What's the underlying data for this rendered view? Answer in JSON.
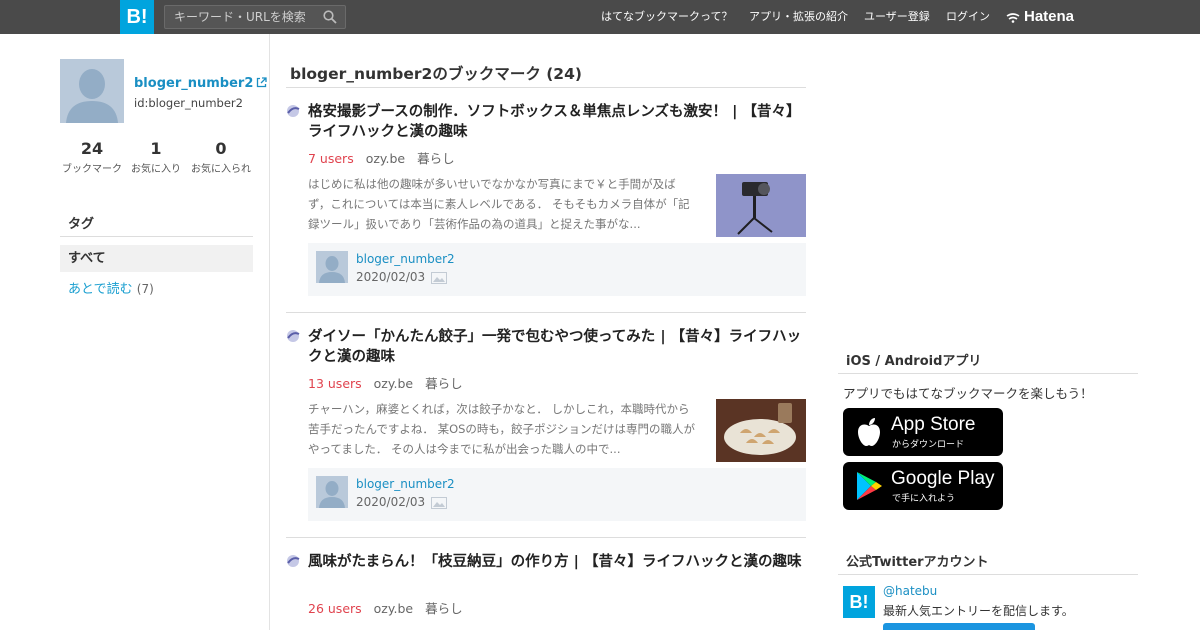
{
  "header": {
    "logo": "B!",
    "search_placeholder": "キーワード・URLを検索",
    "nav": [
      "はてなブックマークって？",
      "アプリ・拡張の紹介",
      "ユーザー登録",
      "ログイン"
    ],
    "brand": "Hatena"
  },
  "profile": {
    "username": "bloger_number2",
    "user_id": "id:bloger_number2",
    "stats": [
      {
        "value": "24",
        "label": "ブックマーク"
      },
      {
        "value": "1",
        "label": "お気に入り"
      },
      {
        "value": "0",
        "label": "お気に入られ"
      }
    ]
  },
  "tags": {
    "heading": "タグ",
    "all_label": "すべて",
    "items": [
      {
        "name": "あとで読む",
        "count": "(7)"
      }
    ]
  },
  "main": {
    "title": "bloger_number2のブックマーク (24)",
    "entries": [
      {
        "title": "格安撮影ブースの制作．ソフトボックス＆単焦点レンズも激安！ | 【昔々】ライフハックと漢の趣味",
        "users": "7 users",
        "domain": "ozy.be",
        "category": "暮らし",
        "description": "はじめに私は他の趣味が多いせいでなかなか写真にまで￥と手間が及ばず，これについては本当に素人レベルである． そもそもカメラ自体が「記録ツール」扱いであり「芸術作品の為の道具」と捉えた事がな...",
        "bookmark_user": "bloger_number2",
        "bookmark_date": "2020/02/03"
      },
      {
        "title": "ダイソー「かんたん餃子」一発で包むやつ使ってみた | 【昔々】ライフハックと漢の趣味",
        "users": "13 users",
        "domain": "ozy.be",
        "category": "暮らし",
        "description": "チャーハン，麻婆とくれば，次は餃子かなと． しかしこれ，本職時代から苦手だったんですよね． 某OSの時も，餃子ポジションだけは専門の職人がやってました． その人は今までに私が出会った職人の中で...",
        "bookmark_user": "bloger_number2",
        "bookmark_date": "2020/02/03"
      },
      {
        "title": "風味がたまらん！「枝豆納豆」の作り方 | 【昔々】ライフハックと漢の趣味",
        "users": "26 users",
        "domain": "ozy.be",
        "category": "暮らし"
      }
    ]
  },
  "right": {
    "apps_heading": "iOS / Androidアプリ",
    "apps_text": "アプリでもはてなブックマークを楽しもう！",
    "appstore_big": "App Store",
    "appstore_small": "からダウンロード",
    "googleplay_big": "Google Play",
    "googleplay_small": "で手に入れよう",
    "twitter_heading": "公式Twitterアカウント",
    "twitter_logo": "B!",
    "twitter_handle": "@hatebu",
    "twitter_desc": "最新人気エントリーを配信します。"
  },
  "colors": {
    "header_bg": "#4a4a4a",
    "brand_blue": "#00a4de",
    "link_blue": "#1a8fc3",
    "users_red": "#e0434e"
  }
}
